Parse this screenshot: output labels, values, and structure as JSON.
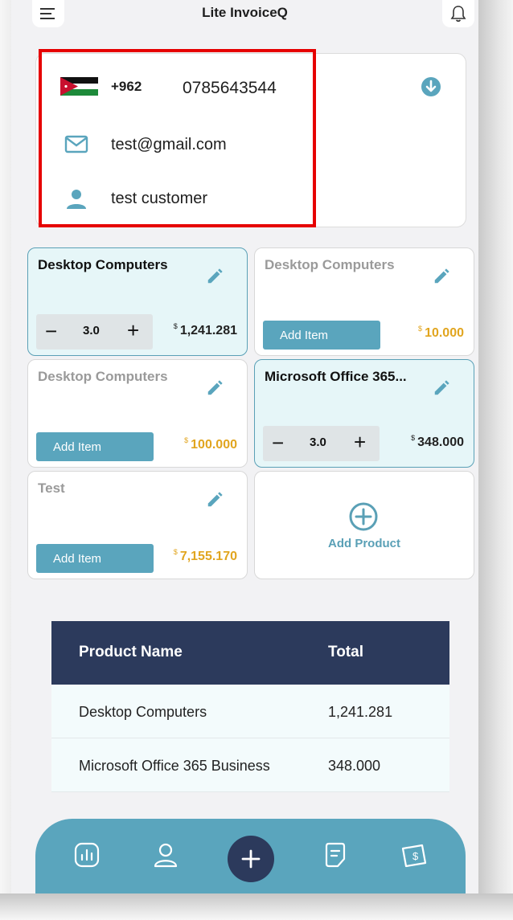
{
  "header": {
    "title": "Lite InvoiceQ",
    "menu_icon": "menu-icon",
    "bell_icon": "bell-icon"
  },
  "customer": {
    "country_code": "+962",
    "phone": "0785643544",
    "email": "test@gmail.com",
    "name": "test customer",
    "flag": "jordan-flag-icon",
    "download_icon": "download-icon"
  },
  "products": [
    {
      "name": "Desktop Computers",
      "price": "1,241.281",
      "currency": "$",
      "in_cart": true,
      "quantity": "3.0"
    },
    {
      "name": "Desktop Computers",
      "price": "10.000",
      "currency": "$",
      "in_cart": false,
      "button": "Add Item"
    },
    {
      "name": "Desktop Computers",
      "price": "100.000",
      "currency": "$",
      "in_cart": false,
      "button": "Add Item"
    },
    {
      "name": "Microsoft Office 365...",
      "price": "348.000",
      "currency": "$",
      "in_cart": true,
      "quantity": "3.0"
    },
    {
      "name": "Test",
      "price": "7,155.170",
      "currency": "$",
      "in_cart": false,
      "button": "Add Item"
    }
  ],
  "add_product": {
    "label": "Add Product"
  },
  "table": {
    "headers": [
      "Product Name",
      "Total"
    ],
    "rows": [
      [
        "Desktop Computers",
        "1,241.281"
      ],
      [
        "Microsoft Office 365 Business",
        "348.000"
      ]
    ]
  },
  "bottom_nav": {
    "items": [
      "reports-icon",
      "customer-icon",
      "add-icon",
      "invoice-icon",
      "payment-icon"
    ]
  },
  "colors": {
    "accent": "#5aa5bd",
    "navy": "#2c3a5c",
    "price": "#e1a51f",
    "highlight": "#e60000"
  }
}
